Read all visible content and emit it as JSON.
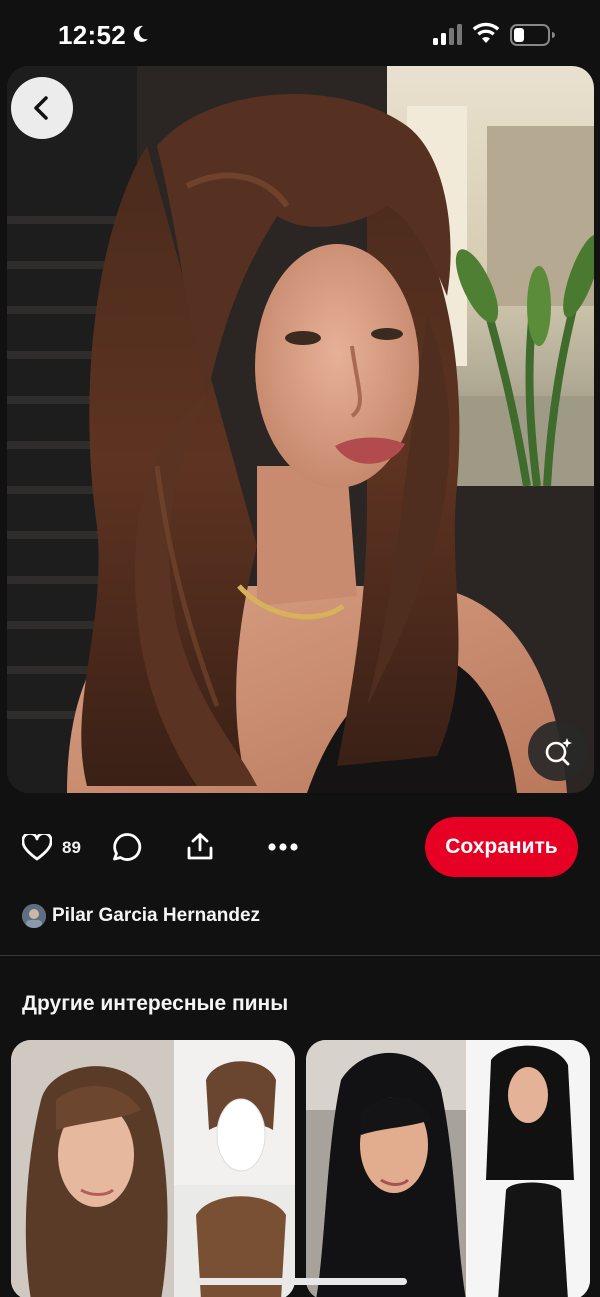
{
  "status_bar": {
    "time": "12:52",
    "icons": [
      "moon-icon",
      "cellular-signal-icon",
      "wifi-icon",
      "battery-icon"
    ]
  },
  "pin": {
    "like_count": "89",
    "save_label": "Сохранить",
    "author_name": "Pilar Garcia Hernandez"
  },
  "related": {
    "title": "Другие интересные пины"
  },
  "colors": {
    "background": "#111111",
    "save_button": "#e60023",
    "text": "#ffffff"
  },
  "icons": {
    "back": "chevron-left-icon",
    "visual_search": "visual-search-sparkle-icon",
    "like": "heart-icon",
    "comment": "comment-bubble-icon",
    "share": "share-upload-icon",
    "more": "more-dots-icon"
  }
}
